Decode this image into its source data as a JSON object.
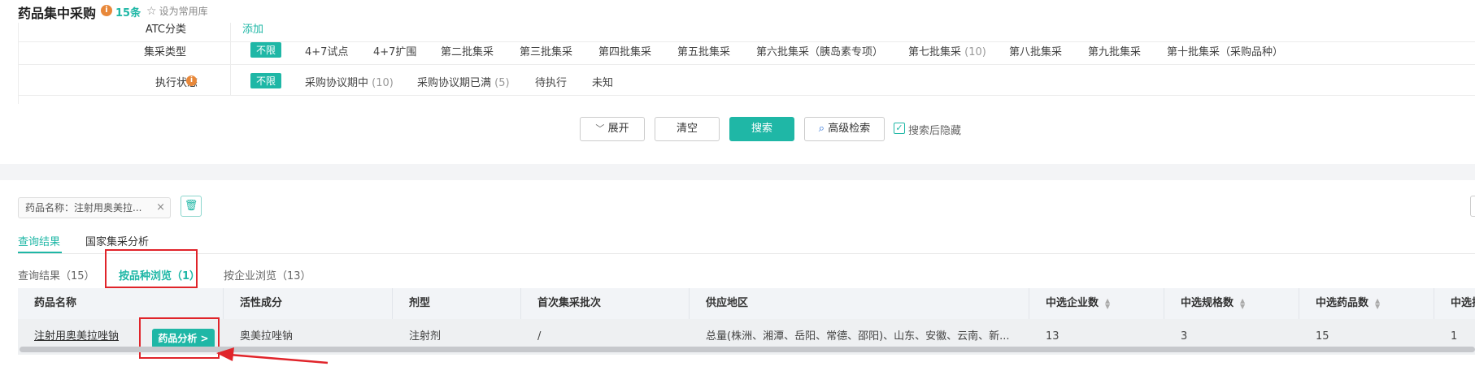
{
  "header": {
    "title": "药品集中采购",
    "info_icon": "info-icon",
    "count": "15条",
    "favorite_label": "设为常用库"
  },
  "filters": {
    "partial_row": {
      "label": "ATC分类",
      "value": "添加"
    },
    "collect_type": {
      "label": "集采类型",
      "options": [
        {
          "label": "不限",
          "count": "",
          "selected": true
        },
        {
          "label": "4+7试点",
          "count": ""
        },
        {
          "label": "4+7扩围",
          "count": ""
        },
        {
          "label": "第二批集采",
          "count": ""
        },
        {
          "label": "第三批集采",
          "count": ""
        },
        {
          "label": "第四批集采",
          "count": ""
        },
        {
          "label": "第五批集采",
          "count": ""
        },
        {
          "label": "第六批集采（胰岛素专项）",
          "count": ""
        },
        {
          "label": "第七批集采",
          "count": "(10)"
        },
        {
          "label": "第八批集采",
          "count": ""
        },
        {
          "label": "第九批集采",
          "count": ""
        },
        {
          "label": "第十批集采（采购品种）",
          "count": ""
        }
      ]
    },
    "exec_status": {
      "label": "执行状态",
      "options": [
        {
          "label": "不限",
          "count": "",
          "selected": true
        },
        {
          "label": "采购协议期中",
          "count": "(10)"
        },
        {
          "label": "采购协议期已满",
          "count": "(5)"
        },
        {
          "label": "待执行",
          "count": ""
        },
        {
          "label": "未知",
          "count": ""
        }
      ]
    }
  },
  "actions": {
    "expand": "展开",
    "clear": "清空",
    "search": "搜索",
    "advanced": "高级检索",
    "hide_after_search": "搜索后隐藏",
    "hide_after_search_checked": true
  },
  "chip": {
    "text": "药品名称：注射用奥美拉...",
    "close": "×"
  },
  "main_tabs": [
    {
      "label": "查询结果",
      "active": true
    },
    {
      "label": "国家集采分析",
      "active": false
    }
  ],
  "sub_tabs": [
    {
      "label": "查询结果",
      "count": "（15）",
      "active": false
    },
    {
      "label": "按品种浏览",
      "count": "（1）",
      "active": true
    },
    {
      "label": "按企业浏览",
      "count": "（13）",
      "active": false
    }
  ],
  "table": {
    "columns": [
      "药品名称",
      "活性成分",
      "剂型",
      "首次集采批次",
      "供应地区",
      "中选企业数",
      "中选规格数",
      "中选药品数",
      "中选批次"
    ],
    "rows": [
      {
        "drug_name": "注射用奥美拉唑钠",
        "analysis_button": "药品分析 >",
        "ingredient": "奥美拉唑钠",
        "dosage_form": "注射剂",
        "first_batch": "/",
        "region": "总量(株洲、湘潭、岳阳、常德、邵阳)、山东、安徽、云南、新...",
        "companies": "13",
        "specs": "3",
        "drugs": "15",
        "batches": "1"
      }
    ]
  },
  "colors": {
    "accent": "#1fb7a6",
    "warning": "#e8883a",
    "annotation": "#e0242a"
  }
}
